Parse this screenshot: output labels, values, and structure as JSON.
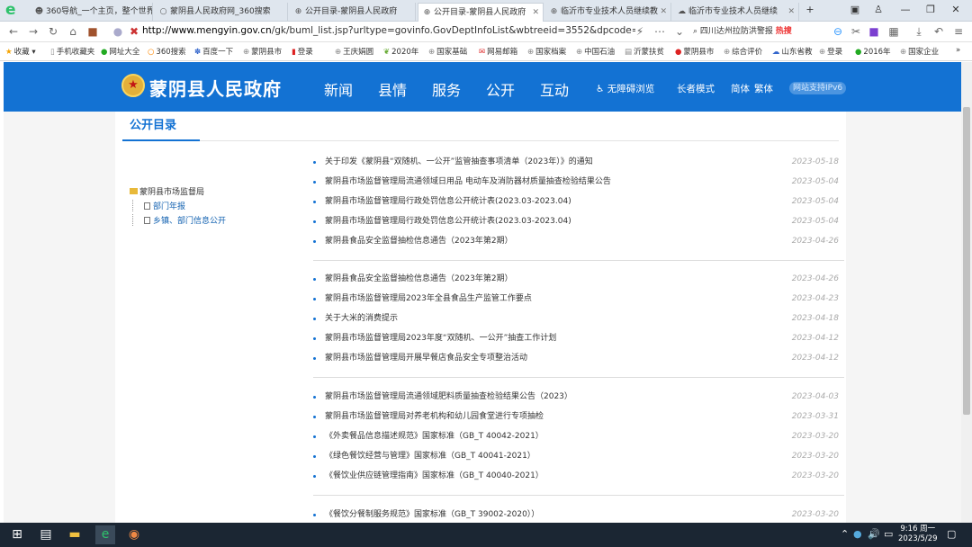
{
  "browser": {
    "tabs": [
      {
        "icon": "360-icon",
        "label": "360导航_一个主页，整个世界"
      },
      {
        "icon": "search-icon",
        "label": "蒙阴县人民政府网_360搜索"
      },
      {
        "icon": "globe-icon",
        "label": "公开目录-蒙阴县人民政府"
      },
      {
        "icon": "globe-icon",
        "label": "公开目录-蒙阴县人民政府"
      },
      {
        "icon": "globe-icon",
        "label": "临沂市专业技术人员继续教"
      },
      {
        "icon": "cloud-icon",
        "label": "临沂市专业技术人员继续"
      }
    ],
    "new_tab": "+",
    "url_host": "http://www.mengyin.gov.cn",
    "url_path": "/gk/buml_list.jsp?urltype=govinfo.GovDeptInfoList&wbtreeid=3552&dpcode=mengyinxianr",
    "search_text": "四川达州拉防洪警报",
    "search_badge": "热搜",
    "bookmarks": [
      "收藏",
      "手机收藏夹",
      "网址大全",
      "360搜索",
      "百度一下",
      "蒙阴县市",
      "登录",
      "王庆娟圆",
      "2020年",
      "国家基础",
      "网易邮箱",
      "国家档案",
      "中国石油",
      "沂蒙扶贫",
      "蒙阴县市",
      "综合评价",
      "山东省教",
      "登录",
      "2016年",
      "国家企业"
    ]
  },
  "site": {
    "title": "蒙阴县人民政府",
    "nav": [
      "新闻",
      "县情",
      "服务",
      "公开",
      "互动"
    ],
    "tools": [
      "无障碍浏览",
      "长者模式",
      "简体",
      "繁体"
    ],
    "ipv6": "网站支持IPv6"
  },
  "section": {
    "title": "公开目录",
    "tree": {
      "root": "蒙阴县市场监督局",
      "children": [
        "部门年报",
        "乡镇、部门信息公开"
      ]
    }
  },
  "articles": [
    {
      "title": "关于印发《蒙阴县“双随机、一公开”监管抽查事项清单（2023年）》的通知",
      "date": "2023-05-18"
    },
    {
      "title": "蒙阴县市场监督管理局流通领域日用品 电动车及消防器材质量抽查检验结果公告",
      "date": "2023-05-04"
    },
    {
      "title": "蒙阴县市场监督管理局行政处罚信息公开统计表(2023.03-2023.04)",
      "date": "2023-05-04"
    },
    {
      "title": "蒙阴县市场监督管理局行政处罚信息公开统计表(2023.03-2023.04)",
      "date": "2023-05-04"
    },
    {
      "title": "蒙阴县食品安全监督抽检信息通告（2023年第2期）",
      "date": "2023-04-26"
    },
    {
      "title": "蒙阴县食品安全监督抽检信息通告（2023年第2期）",
      "date": "2023-04-26"
    },
    {
      "title": "蒙阴县市场监督管理局2023年全县食品生产监管工作要点",
      "date": "2023-04-23"
    },
    {
      "title": "关于大米的消费提示",
      "date": "2023-04-18"
    },
    {
      "title": "蒙阴县市场监督管理局2023年度“双随机、一公开”抽查工作计划",
      "date": "2023-04-12"
    },
    {
      "title": "蒙阴县市场监督管理局开展早餐店食品安全专项整治活动",
      "date": "2023-04-12"
    },
    {
      "title": "蒙阴县市场监督管理局流通领域肥料质量抽查检验结果公告（2023）",
      "date": "2023-04-03"
    },
    {
      "title": "蒙阴县市场监督管理局对养老机构和幼儿园食堂进行专项抽检",
      "date": "2023-03-31"
    },
    {
      "title": "《外卖餐品信息描述规范》国家标准（GB_T 40042-2021）",
      "date": "2023-03-20"
    },
    {
      "title": "《绿色餐饮经营与管理》国家标准（GB_T 40041-2021）",
      "date": "2023-03-20"
    },
    {
      "title": "《餐饮业供应链管理指南》国家标准（GB_T 40040-2021）",
      "date": "2023-03-20"
    },
    {
      "title": "《餐饮分餐制服务规范》国家标准（GB_T 39002-2020））",
      "date": "2023-03-20"
    }
  ],
  "taskbar": {
    "time": "9:16 周一",
    "date": "2023/5/29"
  }
}
